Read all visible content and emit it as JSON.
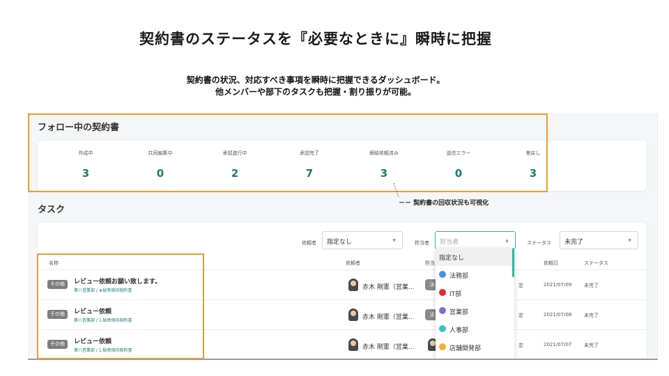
{
  "heading": {
    "title": "契約書のステータスを『必要なときに』瞬時に把握",
    "subtitle_line1": "契約書の状況、対応すべき事項を瞬時に把握できるダッシュボード。",
    "subtitle_line2": "他メンバーや部下のタスクも把握・割り振りが可能。"
  },
  "follow": {
    "title": "フォロー中の契約書",
    "stats": [
      {
        "label": "作成中",
        "value": "3"
      },
      {
        "label": "共同編集中",
        "value": "0"
      },
      {
        "label": "承認進行中",
        "value": "2"
      },
      {
        "label": "承認完了",
        "value": "7"
      },
      {
        "label": "締結依頼済み",
        "value": "3"
      },
      {
        "label": "送信エラー",
        "value": "0"
      },
      {
        "label": "差戻し",
        "value": "3"
      }
    ]
  },
  "annotation": "－－ 契約書の回収状況も可視化",
  "tasks": {
    "title": "タスク",
    "filters": {
      "requester_label": "依頼者",
      "requester_value": "指定なし",
      "assignee_label": "担当者",
      "assignee_placeholder": "担当者",
      "status_label": "ステータス",
      "status_value": "未完了"
    },
    "columns": {
      "name": "名称",
      "requester": "依頼者",
      "assignee": "担当",
      "date": "依頼日",
      "status": "ステータス"
    },
    "rows": [
      {
        "badge": "その他",
        "name": "レビュー依頼お願い致します。",
        "path": "第八営業部 / ★秘密保持契約書",
        "requester": "赤木 剛憲（営業...",
        "chip": "法",
        "cut": "定",
        "date": "2021/07/09",
        "status": "未完了"
      },
      {
        "badge": "その他",
        "name": "レビュー依頼",
        "path": "第八営業部 / 1.秘密保持契約書",
        "requester": "赤木 剛憲（営業...",
        "chip": "法",
        "cut": "定",
        "date": "2021/07/08",
        "status": "未完了"
      },
      {
        "badge": "その他",
        "name": "レビュー依頼",
        "path": "第八営業部 / 1.秘密保持契約書",
        "requester": "赤木 剛憲（営業...",
        "chip": "",
        "cut": "定",
        "date": "2021/07/07",
        "status": "未完了"
      }
    ],
    "dropdown": [
      {
        "text": "指定なし",
        "icon": "",
        "color": ""
      },
      {
        "text": "法務部",
        "icon": "legal-dept-icon",
        "color": "#4a90e2"
      },
      {
        "text": "IT部",
        "icon": "it-dept-icon",
        "color": "#e02f2f"
      },
      {
        "text": "営業部",
        "icon": "sales-dept-icon",
        "color": "#7b6fd6"
      },
      {
        "text": "人事部",
        "icon": "hr-dept-icon",
        "color": "#37c0c8"
      },
      {
        "text": "店舗開発部",
        "icon": "store-dev-dept-icon",
        "color": "#f2b233"
      }
    ]
  }
}
